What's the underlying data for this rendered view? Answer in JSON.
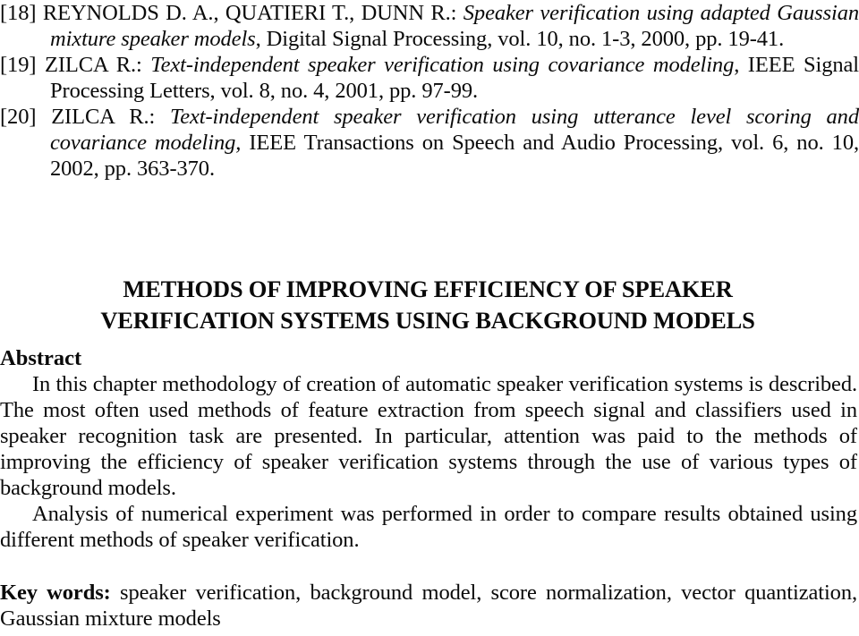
{
  "page": {
    "background_color": "#ffffff",
    "text_color": "#0a0a0a"
  },
  "references": [
    {
      "number": "[18]",
      "authors": "REYNOLDS D. A., QUATIERI T., DUNN R.:",
      "title": "Speaker verification using adapted Gaussian mixture speaker models",
      "source": ", Digital Signal Processing, vol. 10, no. 1-3, 2000, pp. 19-41.",
      "full_text": "[18] REYNOLDS D. A., QUATIERI T., DUNN R.: Speaker verification using adapted Gaussian mixture speaker models, Digital Signal Processing, vol. 10, no. 1-3, 2000, pp. 19-41."
    },
    {
      "number": "[19]",
      "authors": "ZILCA R.:",
      "title": "Text-independent speaker verification using covariance modeling",
      "source": ", IEEE Signal Processing Letters, vol. 8, no. 4, 2001, pp. 97-99.",
      "full_text": "[19] ZILCA R.: Text-independent speaker verification using covariance modeling, IEEE Signal Processing Letters, vol. 8, no. 4, 2001, pp. 97-99."
    },
    {
      "number": "[20]",
      "authors": "ZILCA R.:",
      "title": "Text-independent speaker verification using utterance level scoring and covariance modeling,",
      "source": " IEEE Transactions on Speech and Audio Processing, vol. 6, no. 10, 2002, pp. 363-370.",
      "full_text": "[20] ZILCA R.: Text-independent speaker verification using utterance level scoring and covariance modeling, IEEE Transactions on Speech and Audio Processing, vol. 6, no. 10, 2002, pp. 363-370."
    }
  ],
  "title": {
    "line1": "METHODS OF IMPROVING EFFICIENCY OF SPEAKER",
    "line2": "VERIFICATION SYSTEMS USING BACKGROUND MODELS",
    "full": "METHODS OF IMPROVING EFFICIENCY OF SPEAKER VERIFICATION SYSTEMS USING BACKGROUND MODELS"
  },
  "abstract": {
    "heading": "Abstract",
    "paragraph1": "In this chapter methodology of creation of automatic speaker verification systems is described. The most often used methods of feature extraction from speech signal and classifiers used in speaker recognition task are presented. In particular, attention was paid to the methods of improving the efficiency of speaker verification systems through the use of various types of background models.",
    "paragraph2": "Analysis of numerical experiment was performed in order to compare results obtained using different methods of speaker verification."
  },
  "keywords": {
    "label": "Key words:",
    "list": "speaker verification, background model, score normalization, vector quantization, Gaussian mixture models",
    "items": [
      "speaker verification",
      "background model",
      "score normalization",
      "vector quantization",
      "Gaussian mixture models"
    ]
  }
}
